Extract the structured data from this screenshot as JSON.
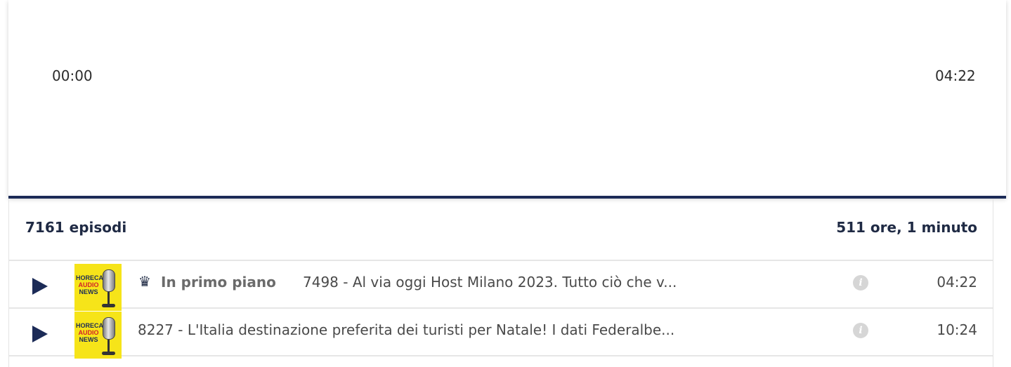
{
  "player": {
    "current_time": "00:00",
    "total_time": "04:22"
  },
  "list": {
    "episode_count": "7161 episodi",
    "total_duration": "511 ore, 1 minuto"
  },
  "cover": {
    "line1": "HORECA",
    "line2": "AUDIO",
    "line3": "NEWS"
  },
  "episodes": [
    {
      "featured_label": "In primo piano",
      "title": "7498 - Al via oggi Host Milano 2023. Tutto ciò che v...",
      "duration": "04:22"
    },
    {
      "title": "8227 - L'Italia destinazione preferita dei turisti per Natale! I dati Federalbe...",
      "duration": "10:24"
    }
  ],
  "icons": {
    "crown": "♛",
    "info": "i"
  },
  "colors": {
    "accent": "#1c2b57",
    "cover_bg": "#f6e419"
  }
}
